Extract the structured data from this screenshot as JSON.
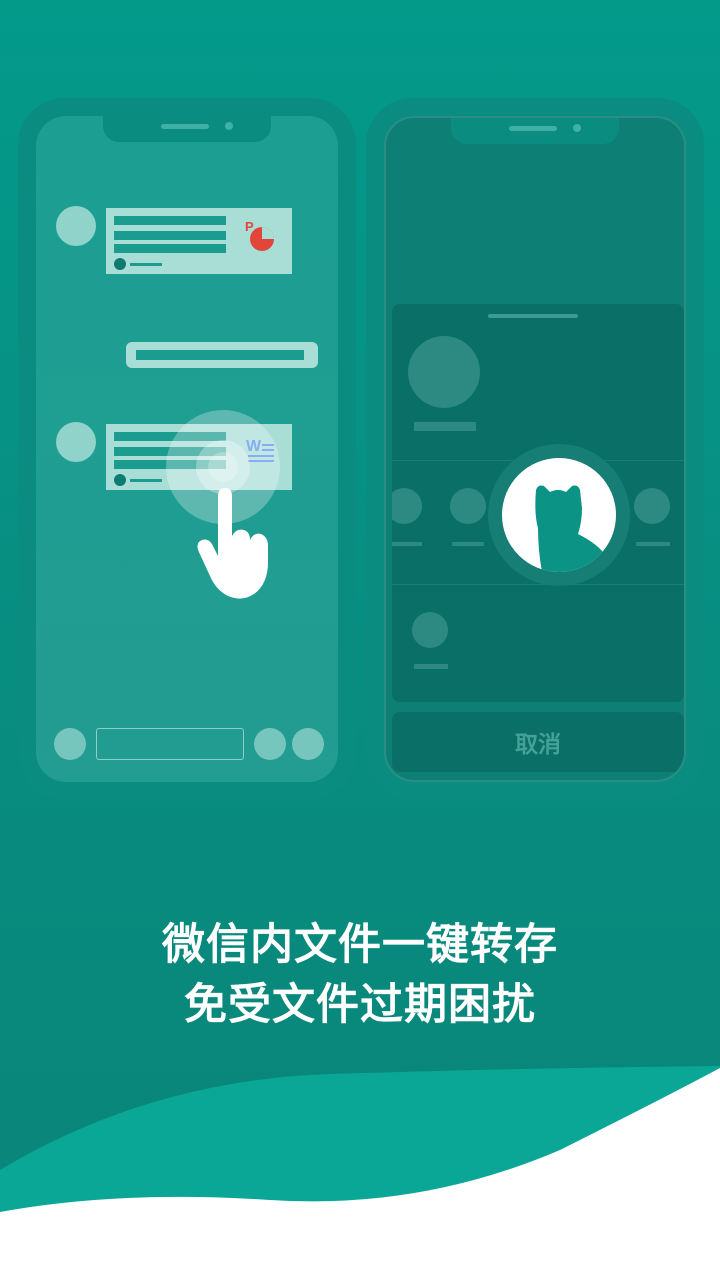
{
  "share_sheet": {
    "cancel_label": "取消"
  },
  "file_icons": {
    "ppt_letter": "P",
    "word_letter": "W"
  },
  "headline": {
    "line1": "微信内文件一键转存",
    "line2": "免受文件过期困扰"
  },
  "icons": [
    "ppt-file-icon",
    "word-file-icon",
    "tap-hand-icon",
    "app-logo-icon"
  ],
  "colors": {
    "brand_teal": "#039a8a",
    "ppt_red": "#e2453a",
    "word_blue": "#5b8ef0",
    "white": "#ffffff"
  }
}
